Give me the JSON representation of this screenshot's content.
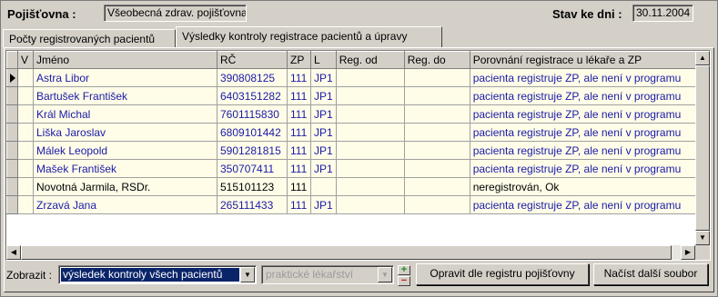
{
  "header": {
    "insurer_label": "Pojišťovna :",
    "insurer_value": "Všeobecná zdrav. pojišťovna",
    "date_label": "Stav ke dni :",
    "date_value": "30.11.2004"
  },
  "tabs": [
    {
      "label": "Počty registrovaných pacientů",
      "active": false
    },
    {
      "label": "Výsledky kontroly registrace pacientů a úpravy",
      "active": true
    }
  ],
  "grid": {
    "columns": [
      "V",
      "Jméno",
      "RČ",
      "ZP",
      "L",
      "Reg. od",
      "Reg. do",
      "Porovnání registrace u lékaře a ZP"
    ],
    "rows": [
      {
        "v": "",
        "name": "Astra Libor",
        "rc": "390808125",
        "zp": "111",
        "l": "JP1",
        "reg_od": "",
        "reg_do": "",
        "compare": "pacienta registruje ZP, ale není v programu"
      },
      {
        "v": "",
        "name": "Bartušek František",
        "rc": "6403151282",
        "zp": "111",
        "l": "JP1",
        "reg_od": "",
        "reg_do": "",
        "compare": "pacienta registruje ZP, ale není v programu"
      },
      {
        "v": "",
        "name": "Král Michal",
        "rc": "7601115830",
        "zp": "111",
        "l": "JP1",
        "reg_od": "",
        "reg_do": "",
        "compare": "pacienta registruje ZP, ale není v programu"
      },
      {
        "v": "",
        "name": "Liška Jaroslav",
        "rc": "6809101442",
        "zp": "111",
        "l": "JP1",
        "reg_od": "",
        "reg_do": "",
        "compare": "pacienta registruje ZP, ale není v programu"
      },
      {
        "v": "",
        "name": "Málek Leopold",
        "rc": "5901281815",
        "zp": "111",
        "l": "JP1",
        "reg_od": "",
        "reg_do": "",
        "compare": "pacienta registruje ZP, ale není v programu"
      },
      {
        "v": "",
        "name": "Mašek František",
        "rc": "350707411",
        "zp": "111",
        "l": "JP1",
        "reg_od": "",
        "reg_do": "",
        "compare": "pacienta registruje ZP, ale není v programu"
      },
      {
        "v": "",
        "name": "Novotná Jarmila, RSDr.",
        "rc": "515101123",
        "zp": "111",
        "l": "",
        "reg_od": "",
        "reg_do": "",
        "compare": "neregistrován, Ok"
      },
      {
        "v": "",
        "name": "Zrzavá Jana",
        "rc": "265111433",
        "zp": "111",
        "l": "JP1",
        "reg_od": "",
        "reg_do": "",
        "compare": "pacienta registruje ZP, ale není v programu"
      }
    ]
  },
  "bottom": {
    "show_label": "Zobrazit :",
    "show_value": "výsledek kontroly všech pacientů",
    "specialty_value": "praktické lékařství",
    "plus": "+",
    "minus": "−",
    "fix_button": "Opravit dle registru pojišťovny",
    "load_button": "Načíst další soubor"
  },
  "colors": {
    "link_blue": "#1a1aa8",
    "row_bg": "#fffde8",
    "selection": "#0a246a"
  }
}
